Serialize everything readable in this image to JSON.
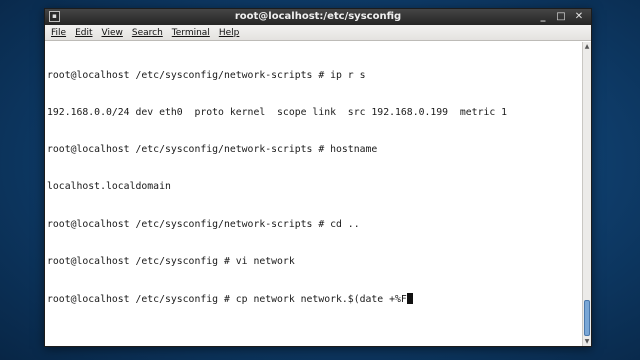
{
  "window": {
    "title": "root@localhost:/etc/sysconfig",
    "app_icon": "terminal-icon",
    "controls": {
      "minimize": "_",
      "maximize": "□",
      "close": "✕"
    }
  },
  "menu": [
    "File",
    "Edit",
    "View",
    "Search",
    "Terminal",
    "Help"
  ],
  "terminal": {
    "lines": [
      "root@localhost /etc/sysconfig/network-scripts # ip r s",
      "192.168.0.0/24 dev eth0  proto kernel  scope link  src 192.168.0.199  metric 1",
      "root@localhost /etc/sysconfig/network-scripts # hostname",
      "localhost.localdomain",
      "root@localhost /etc/sysconfig/network-scripts # cd ..",
      "root@localhost /etc/sysconfig # vi network",
      "root@localhost /etc/sysconfig # cp network network.$(date +%F"
    ]
  },
  "colors": {
    "titlebar": "#2b2b2b",
    "terminal_bg": "#ffffff",
    "scroll_thumb": "#7aa7d6"
  }
}
